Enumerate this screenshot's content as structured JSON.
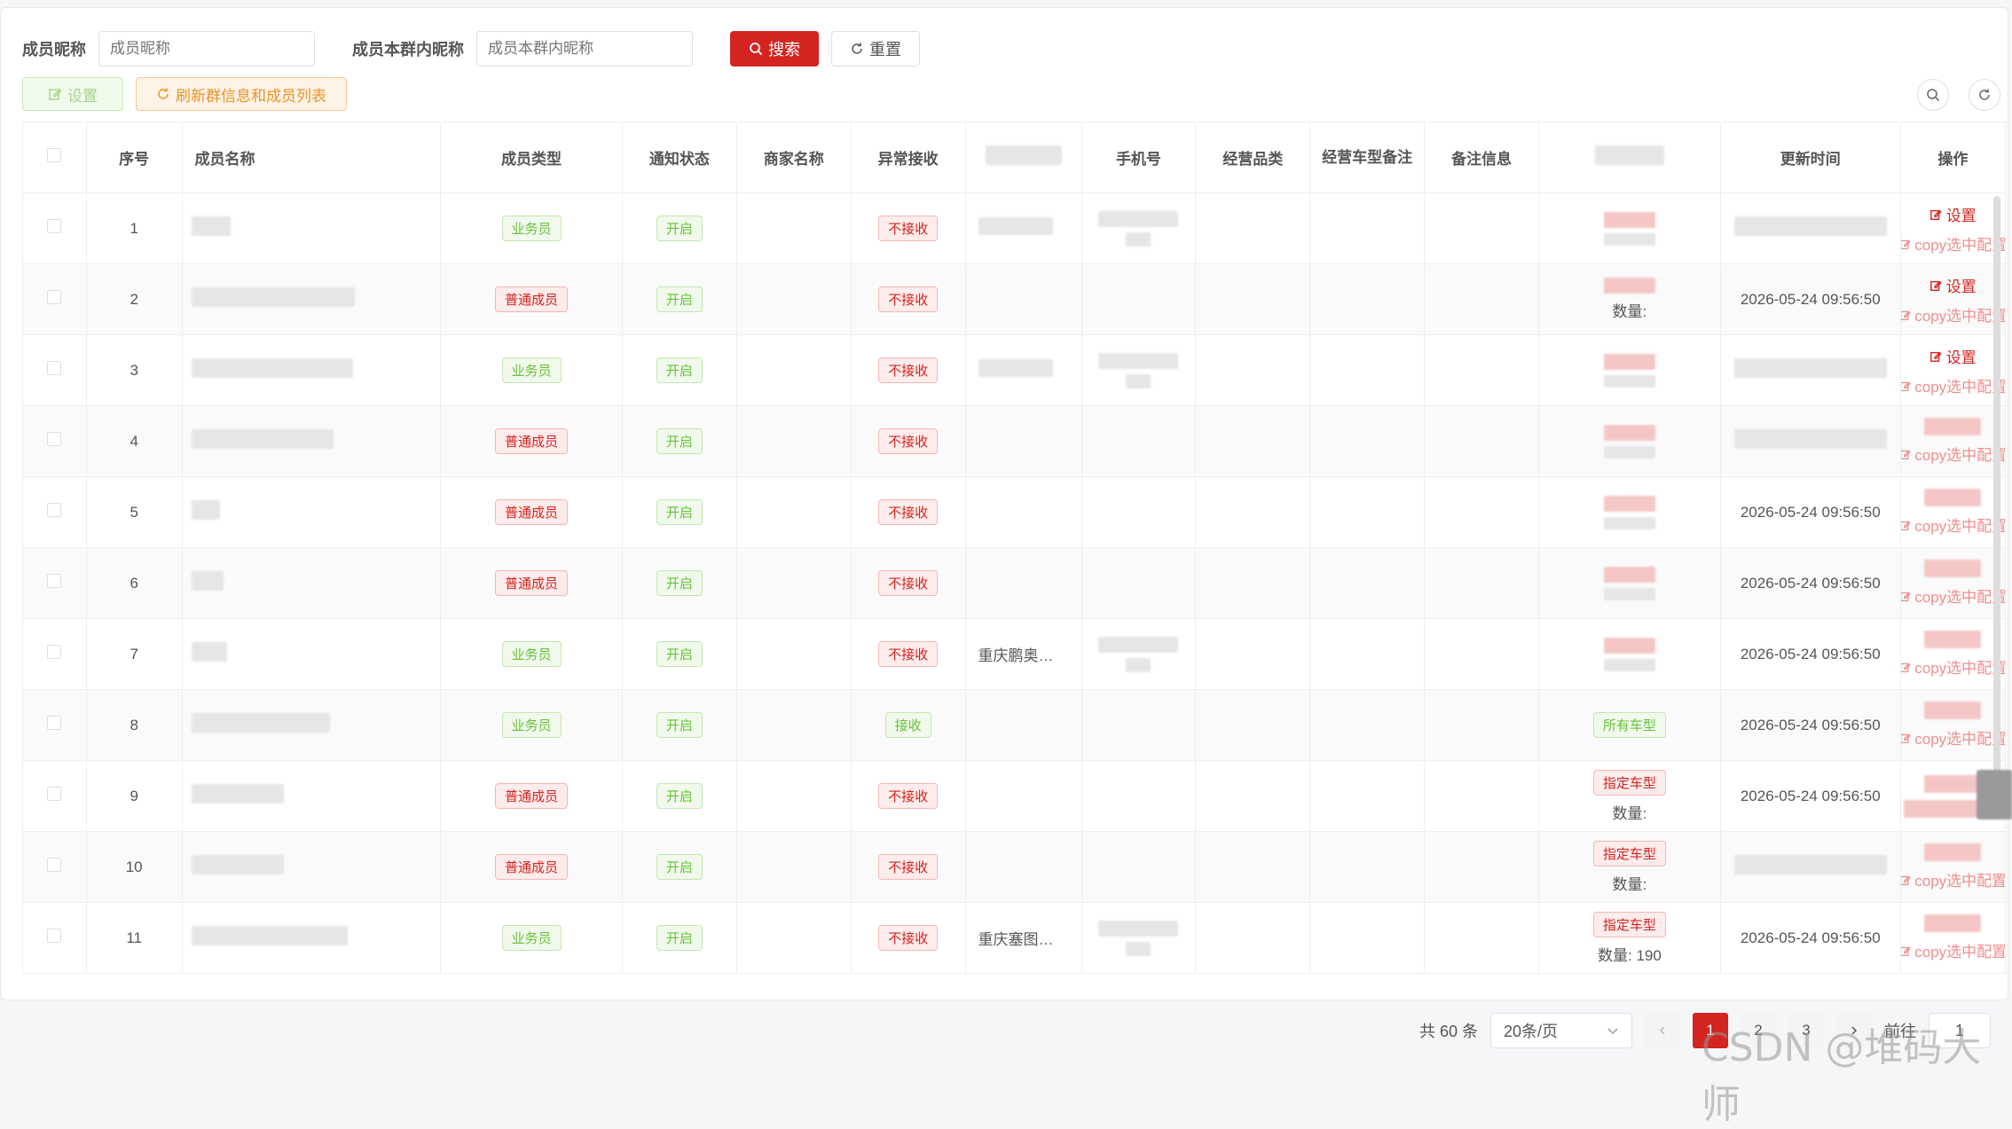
{
  "search": {
    "nickname_label": "成员昵称",
    "nickname_placeholder": "成员昵称",
    "group_nickname_label": "成员本群内昵称",
    "group_nickname_placeholder": "成员本群内昵称",
    "search_button": "搜索",
    "reset_button": "重置"
  },
  "toolbar": {
    "settings_button": "设置",
    "refresh_button": "刷新群信息和成员列表"
  },
  "table": {
    "headers": [
      "序号",
      "成员名称",
      "成员类型",
      "通知状态",
      "商家名称",
      "异常接收",
      "",
      "手机号",
      "经营品类",
      "经营车型备注",
      "备注信息",
      "",
      "更新时间",
      "操作"
    ],
    "rows": [
      {
        "index": "1",
        "type": "业务员",
        "type_color": "green",
        "notify": "开启",
        "exception": "不接收",
        "exception_color": "red",
        "merchant": "",
        "vehicle": "",
        "qty": "",
        "updated": "",
        "ops": [
          "设置",
          "copy选中配置"
        ]
      },
      {
        "index": "2",
        "type": "普通成员",
        "type_color": "red",
        "notify": "开启",
        "exception": "不接收",
        "exception_color": "red",
        "merchant": "",
        "vehicle": "",
        "qty": "数量:",
        "updated": "2026-05-24 09:56:50",
        "ops": [
          "设置",
          "copy选中配置"
        ]
      },
      {
        "index": "3",
        "type": "业务员",
        "type_color": "green",
        "notify": "开启",
        "exception": "不接收",
        "exception_color": "red",
        "merchant": "",
        "vehicle": "",
        "qty": "",
        "updated": "",
        "ops": [
          "设置",
          "copy选中配置"
        ]
      },
      {
        "index": "4",
        "type": "普通成员",
        "type_color": "red",
        "notify": "开启",
        "exception": "不接收",
        "exception_color": "red",
        "merchant": "",
        "vehicle": "",
        "qty": "",
        "updated": "",
        "ops": [
          "",
          "copy选中配置"
        ]
      },
      {
        "index": "5",
        "type": "普通成员",
        "type_color": "red",
        "notify": "开启",
        "exception": "不接收",
        "exception_color": "red",
        "merchant": "",
        "vehicle": "",
        "qty": "",
        "updated": "2026-05-24 09:56:50",
        "ops": [
          "",
          "copy选中配置"
        ]
      },
      {
        "index": "6",
        "type": "普通成员",
        "type_color": "red",
        "notify": "开启",
        "exception": "不接收",
        "exception_color": "red",
        "merchant": "",
        "vehicle": "",
        "qty": "",
        "updated": "2026-05-24 09:56:50",
        "ops": [
          "",
          "copy选中配置"
        ]
      },
      {
        "index": "7",
        "type": "业务员",
        "type_color": "green",
        "notify": "开启",
        "exception": "不接收",
        "exception_color": "red",
        "merchant": "重庆鹏奥…",
        "vehicle": "",
        "qty": "",
        "updated": "2026-05-24 09:56:50",
        "ops": [
          "",
          "copy选中配置"
        ]
      },
      {
        "index": "8",
        "type": "业务员",
        "type_color": "green",
        "notify": "开启",
        "exception": "接收",
        "exception_color": "green",
        "merchant": "",
        "vehicle": "所有车型",
        "vehicle_color": "green",
        "qty": "",
        "updated": "2026-05-24 09:56:50",
        "ops": [
          "",
          "copy选中配置"
        ]
      },
      {
        "index": "9",
        "type": "普通成员",
        "type_color": "red",
        "notify": "开启",
        "exception": "不接收",
        "exception_color": "red",
        "merchant": "",
        "vehicle": "指定车型",
        "vehicle_color": "red",
        "qty": "数量:",
        "updated": "2026-05-24 09:56:50",
        "ops": [
          "",
          ""
        ]
      },
      {
        "index": "10",
        "type": "普通成员",
        "type_color": "red",
        "notify": "开启",
        "exception": "不接收",
        "exception_color": "red",
        "merchant": "",
        "vehicle": "指定车型",
        "vehicle_color": "red",
        "qty": "数量:",
        "updated": "",
        "ops": [
          "",
          "copy选中配置"
        ]
      },
      {
        "index": "11",
        "type": "业务员",
        "type_color": "green",
        "notify": "开启",
        "exception": "不接收",
        "exception_color": "red",
        "merchant": "重庆塞图…",
        "vehicle": "指定车型",
        "vehicle_color": "red",
        "qty": "数量:  190",
        "updated": "2026-05-24 09:56:50",
        "ops": [
          "",
          "copy选中配置"
        ]
      }
    ]
  },
  "pagination": {
    "total": "共 60 条",
    "page_size": "20条/页",
    "pages": [
      "1",
      "2",
      "3"
    ],
    "current_page": "1",
    "jump_label": "前往",
    "jump_value": "1"
  },
  "watermark": "CSDN @堆码大师",
  "colors": {
    "primary": "#d42420",
    "success": "#67c23a",
    "warning": "#e8952a"
  }
}
